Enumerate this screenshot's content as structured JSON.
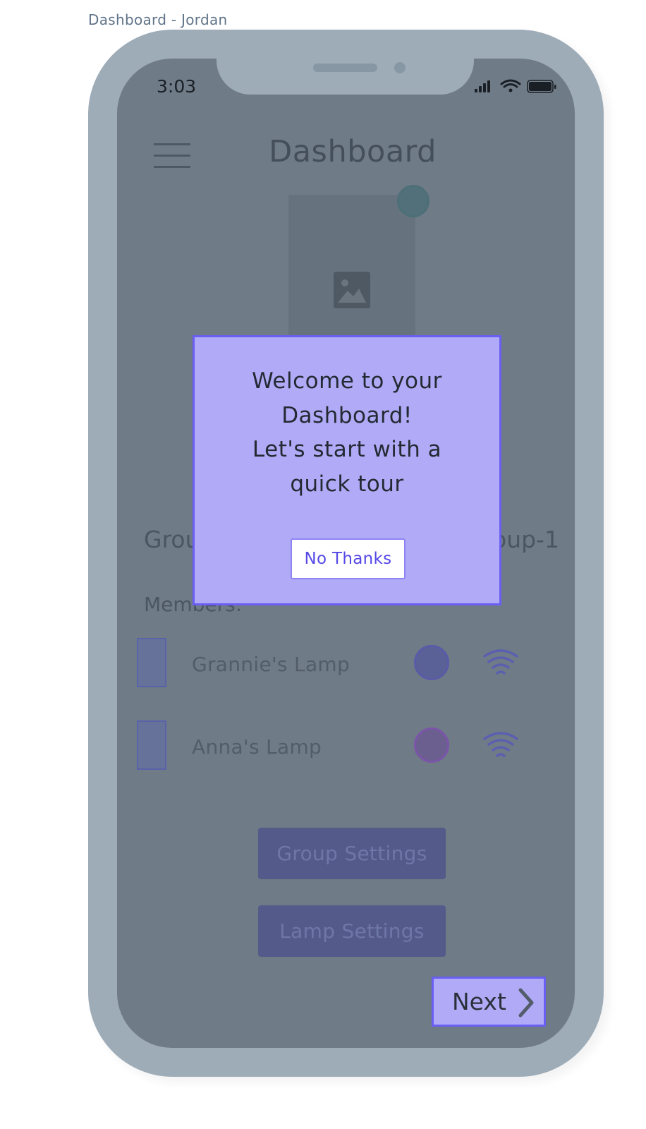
{
  "artboard": {
    "title": "Dashboard - Jordan"
  },
  "status_bar": {
    "time": "3:03",
    "icons": [
      "cellular-signal-icon",
      "wifi-icon",
      "battery-icon"
    ]
  },
  "header": {
    "menu_icon": "hamburger-menu-icon",
    "title": "Dashboard"
  },
  "hero": {
    "image_icon": "image-placeholder-icon",
    "status_color": "#52707a"
  },
  "group": {
    "label_visible": "Grou",
    "name_visible": "oup-1"
  },
  "members": {
    "label": "Members:",
    "items": [
      {
        "name": "Grannie's Lamp",
        "dot_color": "#5a6197",
        "dot_border": "#5a5ba6",
        "signal_icon": "wifi-signal-icon"
      },
      {
        "name": "Anna's Lamp",
        "dot_color": "#6b5f8f",
        "dot_border": "#7a55a8",
        "signal_icon": "wifi-signal-icon"
      }
    ]
  },
  "actions": {
    "group_settings": "Group Settings",
    "lamp_settings": "Lamp Settings"
  },
  "modal": {
    "lines": [
      "Welcome to your",
      "Dashboard!",
      "Let's start with a",
      "quick tour"
    ],
    "dismiss_label": "No Thanks"
  },
  "tour": {
    "next_label": "Next",
    "next_icon": "chevron-right-icon"
  },
  "colors": {
    "accent": "#6a5ff2",
    "modal_bg": "#b1abf7",
    "overlay": "#6f7b86",
    "device_frame": "#9eacb8"
  }
}
